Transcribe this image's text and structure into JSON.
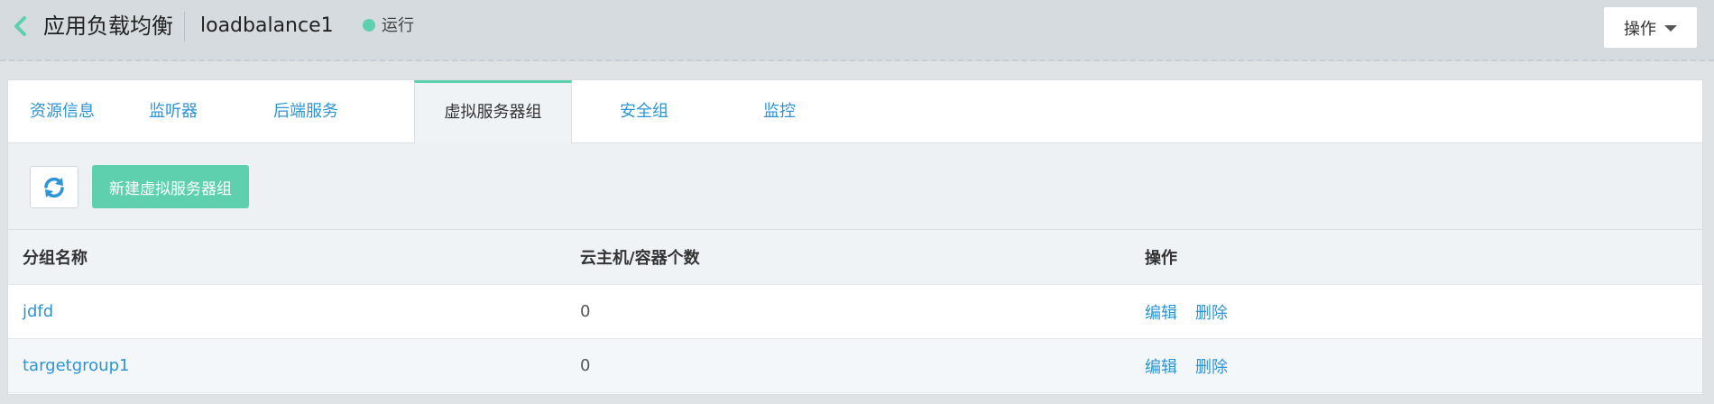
{
  "header": {
    "back_icon": "chevron-left-icon",
    "accent_color": "#5fd0ad",
    "title": "应用负载均衡",
    "lb_name": "loadbalance1",
    "status": "运行",
    "ops_label": "操作"
  },
  "tabs": [
    {
      "label": "资源信息"
    },
    {
      "label": "监听器"
    },
    {
      "label": "后端服务"
    },
    {
      "label": "虚拟服务器组",
      "active": true
    },
    {
      "label": "安全组"
    },
    {
      "label": "监控"
    }
  ],
  "toolbar": {
    "refresh_icon": "refresh-icon",
    "new_button": "新建虚拟服务器组"
  },
  "table": {
    "columns": [
      "分组名称",
      "云主机/容器个数",
      "操作"
    ],
    "rows": [
      {
        "name": "jdfd",
        "count": "0",
        "actions": [
          "编辑",
          "删除"
        ]
      },
      {
        "name": "targetgroup1",
        "count": "0",
        "actions": [
          "编辑",
          "删除"
        ]
      }
    ]
  }
}
